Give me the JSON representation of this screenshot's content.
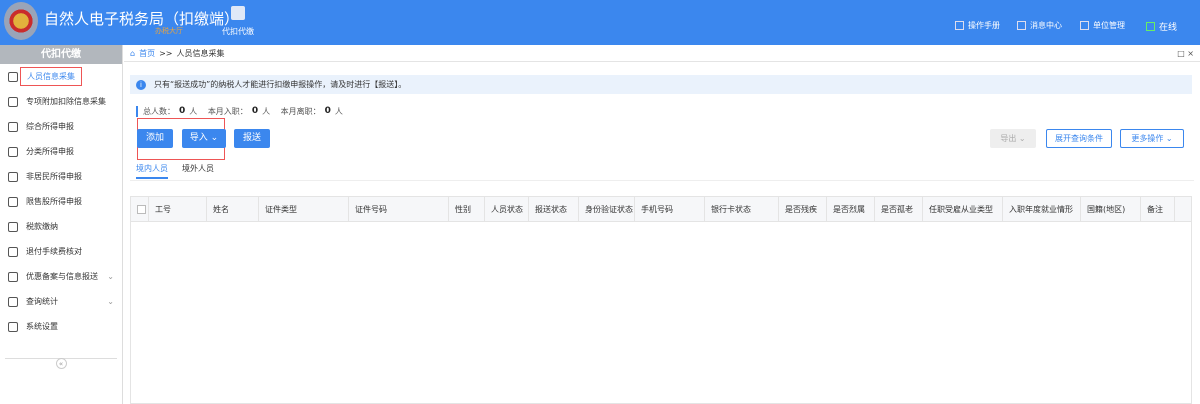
{
  "header": {
    "title": "自然人电子税务局（扣缴端）",
    "subtitle": "办税大厅",
    "module_tab": "代扣代缴",
    "links": [
      {
        "label": "操作手册",
        "icon": "manual-icon"
      },
      {
        "label": "消息中心",
        "icon": "mail-icon"
      },
      {
        "label": "单位管理",
        "icon": "building-icon"
      },
      {
        "label": "在线",
        "icon": "monitor-icon"
      }
    ]
  },
  "sidebar": {
    "header": "代扣代缴",
    "items": [
      {
        "label": "人员信息采集",
        "icon": "person-icon",
        "active": true
      },
      {
        "label": "专项附加扣除信息采集",
        "icon": "list-icon"
      },
      {
        "label": "综合所得申报",
        "icon": "layers-icon"
      },
      {
        "label": "分类所得申报",
        "icon": "pie-icon"
      },
      {
        "label": "非居民所得申报",
        "icon": "user-icon"
      },
      {
        "label": "限售股所得申报",
        "icon": "bar-chart-icon"
      },
      {
        "label": "税款缴纳",
        "icon": "folder-icon"
      },
      {
        "label": "退付手续费核对",
        "icon": "receipt-icon"
      },
      {
        "label": "优惠备案与信息报送",
        "icon": "document-icon",
        "expandable": true
      },
      {
        "label": "查询统计",
        "icon": "search-doc-icon",
        "expandable": true
      },
      {
        "label": "系统设置",
        "icon": "gear-icon"
      }
    ],
    "collapse": "«"
  },
  "breadcrumb": {
    "home": "首页",
    "sep": ">>",
    "current": "人员信息采集"
  },
  "window": {
    "restore": "□",
    "close": "×"
  },
  "notice": "只有“报送成功”的纳税人才能进行扣缴申报操作，请及时进行【报送】。",
  "stats": {
    "total_label": "总人数：",
    "total": "0",
    "unit": "人",
    "join_label": "本月入职：",
    "join": "0",
    "leave_label": "本月离职：",
    "leave": "0"
  },
  "buttons": {
    "add": "添加",
    "import": "导入",
    "submit": "报送",
    "export": "导出",
    "expand_query": "展开查询条件",
    "more": "更多操作"
  },
  "tabs": [
    "境内人员",
    "境外人员"
  ],
  "table": {
    "columns": [
      "工号",
      "姓名",
      "证件类型",
      "证件号码",
      "性别",
      "人员状态",
      "报送状态",
      "身份验证状态",
      "手机号码",
      "银行卡状态",
      "是否残疾",
      "是否烈属",
      "是否孤老",
      "任职受雇从业类型",
      "入职年度就业情形",
      "国籍(地区)",
      "备注"
    ],
    "rows": []
  }
}
